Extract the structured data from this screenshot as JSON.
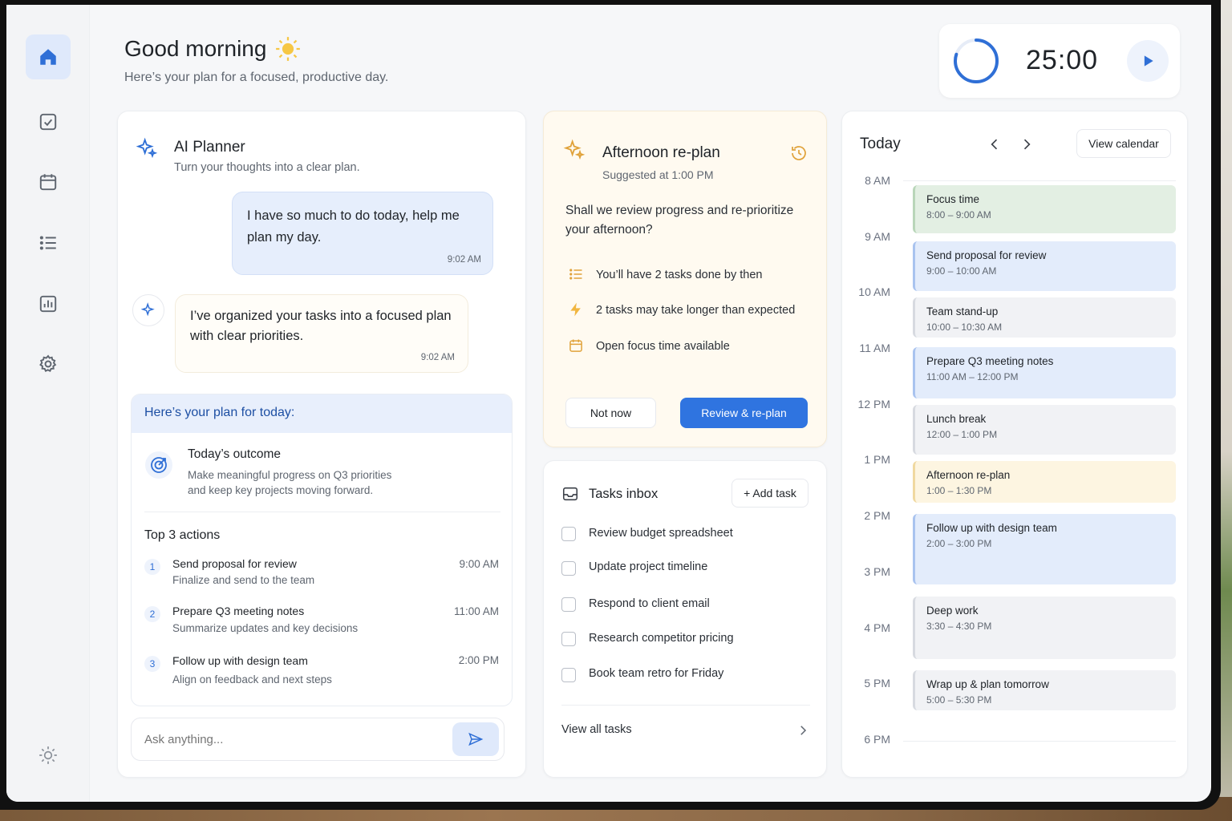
{
  "header": {
    "greeting": "Good morning",
    "subtitle": "Here’s your plan for a focused, productive day."
  },
  "timer": {
    "time": "25:00",
    "progress": 0.8
  },
  "sidebar": {
    "items": [
      {
        "icon": "home-icon",
        "active": true
      },
      {
        "icon": "checkbox-icon"
      },
      {
        "icon": "calendar-icon"
      },
      {
        "icon": "list-icon"
      },
      {
        "icon": "chart-icon"
      },
      {
        "icon": "gear-icon"
      }
    ],
    "bottom_icon": "sun-icon"
  },
  "ai_planner": {
    "title": "AI Planner",
    "subtitle": "Turn your thoughts into a clear plan.",
    "user_message": "I have so much to do today, help me plan my day.",
    "user_time": "9:02 AM",
    "ai_message": "I’ve organized your tasks into a focused plan with clear priorities.",
    "ai_time": "9:02 AM",
    "plan_heading": "Here’s your plan for today:",
    "outcome_title": "Today’s outcome",
    "outcome_text": "Make meaningful progress on Q3 priorities and keep key projects moving forward.",
    "top_actions_title": "Top 3 actions",
    "actions": [
      {
        "num": "1",
        "title": "Send proposal for review",
        "desc": "Finalize and send to the team",
        "time": "9:00 AM"
      },
      {
        "num": "2",
        "title": "Prepare Q3 meeting notes",
        "desc": "Summarize updates and key decisions",
        "time": "11:00 AM"
      },
      {
        "num": "3",
        "title": "Follow up with design team",
        "desc": "Align on feedback and next steps",
        "time": "2:00 PM"
      }
    ],
    "ask_placeholder": "Ask anything..."
  },
  "replan": {
    "title": "Afternoon re-plan",
    "suggested": "Suggested at 1:00 PM",
    "question": "Shall we review progress and re-prioritize your afternoon?",
    "insights": [
      {
        "icon": "list-icon",
        "text": "You’ll have 2 tasks done by then"
      },
      {
        "icon": "lightning-icon",
        "text": "2 tasks may take longer than expected"
      },
      {
        "icon": "calendar-icon",
        "text": "Open focus time available"
      }
    ],
    "not_now": "Not now",
    "review": "Review & re-plan"
  },
  "inbox": {
    "title": "Tasks inbox",
    "add_task": "+ Add task",
    "tasks": [
      "Review budget spreadsheet",
      "Update project timeline",
      "Respond to client email",
      "Research competitor pricing",
      "Book team retro for Friday"
    ],
    "view_all": "View all tasks"
  },
  "today": {
    "title": "Today",
    "view_calendar": "View calendar",
    "hours": [
      "8 AM",
      "9 AM",
      "10 AM",
      "11 AM",
      "12 PM",
      "1 PM",
      "2 PM",
      "3 PM",
      "4 PM",
      "5 PM",
      "6 PM"
    ],
    "events": [
      {
        "name": "Focus time",
        "time": "8:00 – 9:00 AM",
        "color": "#e3efe3",
        "accent": "#b9d6b9"
      },
      {
        "name": "Send proposal for review",
        "time": "9:00 – 10:00 AM",
        "color": "#e3ecfb",
        "accent": "#a9c3ef"
      },
      {
        "name": "Team stand-up",
        "time": "10:00 – 10:30 AM",
        "color": "#f1f2f5",
        "accent": "#d7dae0"
      },
      {
        "name": "Prepare Q3 meeting notes",
        "time": "11:00 AM – 12:00 PM",
        "color": "#e3ecfb",
        "accent": "#a9c3ef"
      },
      {
        "name": "Lunch break",
        "time": "12:00 – 1:00 PM",
        "color": "#f1f2f5",
        "accent": "#d7dae0"
      },
      {
        "name": "Afternoon re-plan",
        "time": "1:00 – 1:30 PM",
        "color": "#fdf5e1",
        "accent": "#f0d9a0"
      },
      {
        "name": "Follow up with design team",
        "time": "2:00 – 3:00 PM",
        "color": "#e3ecfb",
        "accent": "#a9c3ef"
      },
      {
        "name": "Deep work",
        "time": "3:30 – 4:30 PM",
        "color": "#f1f2f5",
        "accent": "#d7dae0"
      },
      {
        "name": "Wrap up & plan tomorrow",
        "time": "5:00 – 5:30 PM",
        "color": "#f1f2f5",
        "accent": "#d7dae0"
      }
    ]
  }
}
